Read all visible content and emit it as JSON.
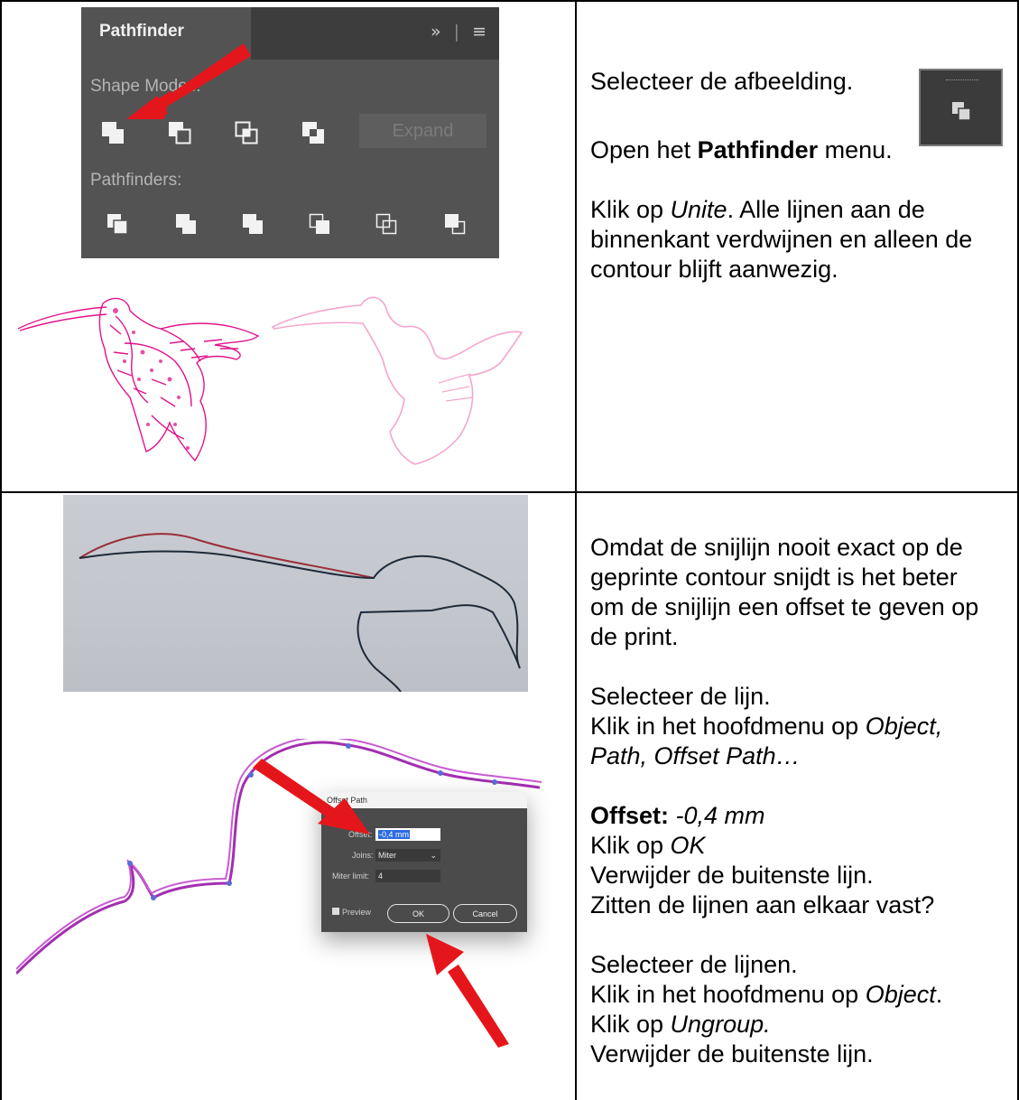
{
  "pathfinder_panel": {
    "tab_title": "Pathfinder",
    "overflow_glyph": "»",
    "menu_icon": "hamburger-menu-icon",
    "shape_modes_label": "Shape Modes:",
    "pathfinders_label": "Pathfinders:",
    "expand_label": "Expand",
    "shape_mode_icons": [
      "unite-icon",
      "minus-front-icon",
      "intersect-icon",
      "exclude-icon"
    ],
    "pathfinder_icons": [
      "divide-icon",
      "trim-icon",
      "merge-icon",
      "crop-icon",
      "outline-icon",
      "minus-back-icon"
    ]
  },
  "hummingbird": {
    "stroke_color": "#e0138a",
    "outline_color": "#f3a6cf"
  },
  "cell1": {
    "line1": "Selecteer de afbeelding.",
    "line2_prefix": "Open het ",
    "line2_bold": "Pathfinder",
    "line2_suffix": " menu.",
    "line3_prefix": "Klik op ",
    "line3_italic": "Unite",
    "line3_suffix": ". Alle lijnen aan de",
    "line4": "binnenkant verdwijnen en alleen de",
    "line5": "contour blijft aanwezig.",
    "pathfinder_button_icon": "pathfinder-panel-icon"
  },
  "offset_dialog": {
    "title": "Offset Path",
    "offset_label": "Offset:",
    "offset_value": "-0,4 mm",
    "joins_label": "Joins:",
    "joins_value": "Miter",
    "miter_label": "Miter limit:",
    "miter_value": "4",
    "preview_label": "Preview",
    "ok_label": "OK",
    "cancel_label": "Cancel"
  },
  "cell2": {
    "p1_l1": "Omdat de snijlijn nooit exact op de",
    "p1_l2": "geprinte contour snijdt is het beter",
    "p1_l3": "om de snijlijn een offset te geven op",
    "p1_l4": "de print.",
    "p2_l1": "Selecteer de lijn.",
    "p2_l2": "Klik in het hoofdmenu op ",
    "p2_l2_italic": "Object,",
    "p2_l3_italic": "Path, Offset Path…",
    "p3_bold": "Offset:",
    "p3_italic": " -0,4 mm",
    "p3_l2": "Klik op ",
    "p3_l2_italic": "OK",
    "p3_l3": "Verwijder de buitenste lijn.",
    "p3_l4": "Zitten de lijnen aan elkaar vast?",
    "p4_l1": "Selecteer de lijnen.",
    "p4_l2": "Klik in het hoofdmenu op ",
    "p4_l2_italic": "Object",
    "p4_l2_end": ".",
    "p4_l3": "Klik op ",
    "p4_l3_italic": "Ungroup.",
    "p4_l4": "Verwijder de buitenste lijn."
  }
}
